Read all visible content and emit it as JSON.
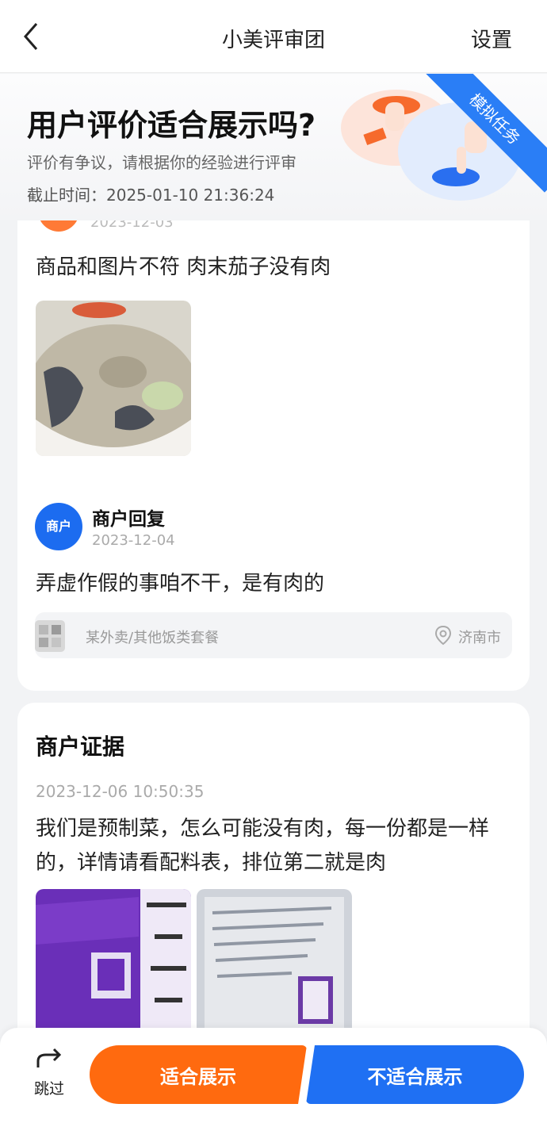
{
  "nav": {
    "title": "小美评审团",
    "settings_label": "设置"
  },
  "banner": {
    "title": "用户评价适合展示吗?",
    "subtitle": "评价有争议，请根据你的经验进行评审",
    "deadline": "截止时间：2025-01-10 21:36:24",
    "ribbon": "模拟任务"
  },
  "review": {
    "date_partial": "2023-12-03",
    "text": "商品和图片不符 肉末茄子没有肉"
  },
  "merchant_reply": {
    "avatar_label": "商户",
    "name": "商户回复",
    "date": "2023-12-04",
    "text": "弄虚作假的事咱不干，是有肉的"
  },
  "shop": {
    "name": "某外卖/其他饭类套餐",
    "location": "济南市"
  },
  "evidence": {
    "title": "商户证据",
    "datetime": "2023-12-06 10:50:35",
    "text": "我们是预制菜，怎么可能没有肉，每一份都是一样的，详情请看配料表，排位第二就是肉"
  },
  "actions": {
    "skip_label": "跳过",
    "suitable_label": "适合展示",
    "unsuitable_label": "不适合展示"
  },
  "colors": {
    "orange": "#ff6a0f",
    "blue": "#1f70f3"
  }
}
